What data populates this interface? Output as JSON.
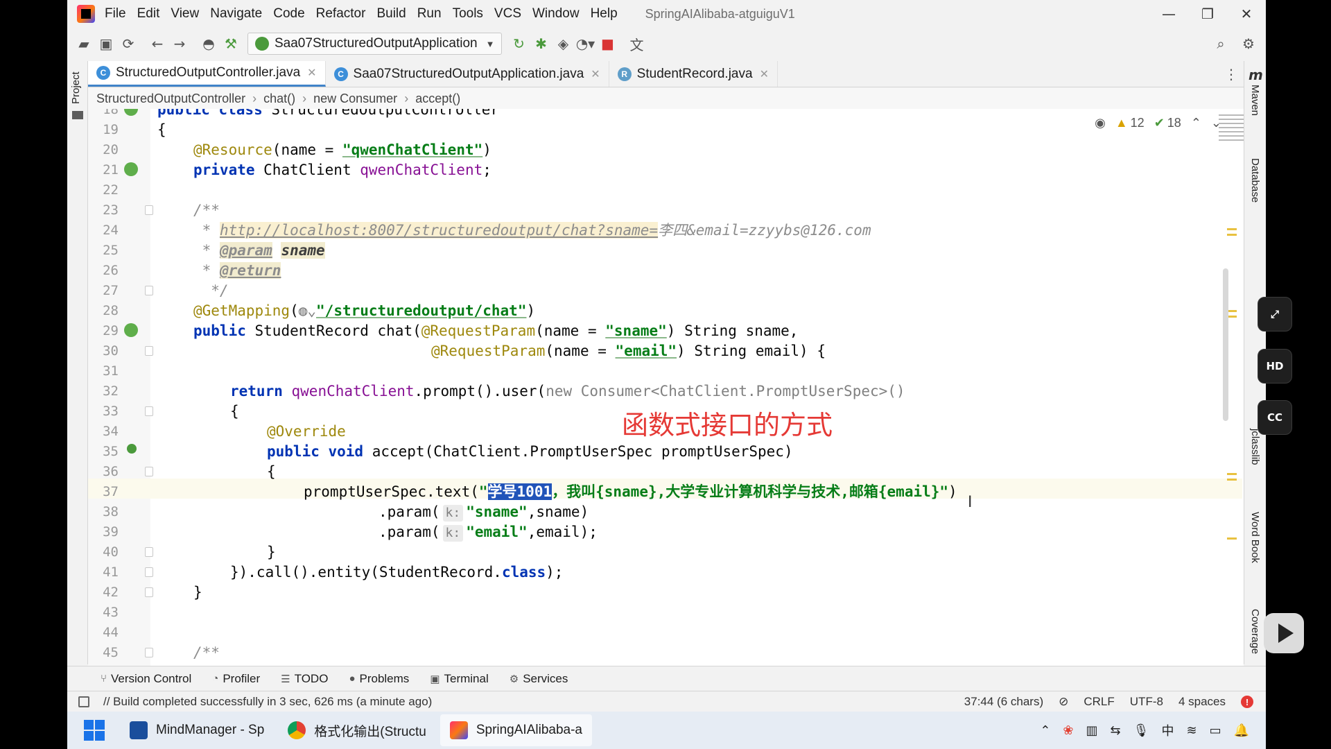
{
  "window": {
    "menu": [
      "File",
      "Edit",
      "View",
      "Navigate",
      "Code",
      "Refactor",
      "Build",
      "Run",
      "Tools",
      "VCS",
      "Window",
      "Help"
    ],
    "project_title": "SpringAIAlibaba-atguiguV1",
    "minimize": "—",
    "maximize": "❐",
    "close": "✕"
  },
  "toolbar": {
    "run_config": "Saa07StructuredOutputApplication",
    "icons": [
      "open-icon",
      "save-icon",
      "sync-icon",
      "back-icon",
      "forward-icon",
      "user-icon",
      "build-hammer-icon",
      "rerun-icon",
      "debug-icon",
      "coverage-icon",
      "profile-icon",
      "stop-icon",
      "translate-icon",
      "search-icon",
      "settings-icon"
    ]
  },
  "left_strip": {
    "project_label": "Project"
  },
  "right_strip": {
    "maven": "Maven",
    "database": "Database",
    "jclasslib": "jclasslib",
    "word_book": "Word Book",
    "coverage": "Coverage"
  },
  "tabs": [
    {
      "label": "StructuredOutputController.java",
      "icon": "C",
      "active": true
    },
    {
      "label": "Saa07StructuredOutputApplication.java",
      "icon": "C",
      "active": false
    },
    {
      "label": "StudentRecord.java",
      "icon": "R",
      "active": false
    }
  ],
  "breadcrumb": [
    "StructuredOutputController",
    "chat()",
    "new Consumer",
    "accept()"
  ],
  "inspections": {
    "warnings": "12",
    "weak_warnings": "18"
  },
  "editor": {
    "cursor_line": "37",
    "annotation_note": "函数式接口的方式",
    "lines": [
      {
        "n": "18",
        "text": "public class StructuredOutputController"
      },
      {
        "n": "19",
        "text": "{"
      },
      {
        "n": "20",
        "text": "@Resource(name = \"qwenChatClient\")"
      },
      {
        "n": "21",
        "text": "private ChatClient qwenChatClient;"
      },
      {
        "n": "22",
        "text": ""
      },
      {
        "n": "23",
        "text": "/**"
      },
      {
        "n": "24",
        "text": "http://localhost:8007/structuredoutput/chat?sname=李四&email=zzyybs@126.com"
      },
      {
        "n": "25",
        "text": "@param sname"
      },
      {
        "n": "26",
        "text": "@return"
      },
      {
        "n": "27",
        "text": "*/"
      },
      {
        "n": "28",
        "text": "@GetMapping(\"/structuredoutput/chat\")"
      },
      {
        "n": "29",
        "text": "public StudentRecord chat(@RequestParam(name = \"sname\") String sname,"
      },
      {
        "n": "30",
        "text": "@RequestParam(name = \"email\") String email) {"
      },
      {
        "n": "31",
        "text": ""
      },
      {
        "n": "32",
        "text": "return qwenChatClient.prompt().user(new Consumer<ChatClient.PromptUserSpec>()"
      },
      {
        "n": "33",
        "text": "{"
      },
      {
        "n": "34",
        "text": "@Override"
      },
      {
        "n": "35",
        "text": "public void accept(ChatClient.PromptUserSpec promptUserSpec)"
      },
      {
        "n": "36",
        "text": "{"
      },
      {
        "n": "37",
        "text": "promptUserSpec.text(\"学号1001，我叫{sname},大学专业计算机科学与技术,邮箱{email}\")"
      },
      {
        "n": "38",
        "text": ".param( k: \"sname\",sname)"
      },
      {
        "n": "39",
        "text": ".param( k: \"email\",email);"
      },
      {
        "n": "40",
        "text": "}"
      },
      {
        "n": "41",
        "text": "}).call().entity(StudentRecord.class);"
      },
      {
        "n": "42",
        "text": "}"
      },
      {
        "n": "43",
        "text": ""
      },
      {
        "n": "44",
        "text": ""
      },
      {
        "n": "45",
        "text": "/**"
      }
    ],
    "selection": "学号1001"
  },
  "toolwindows": [
    {
      "label": "Version Control",
      "icon": "branch-icon"
    },
    {
      "label": "Profiler",
      "icon": "profiler-icon"
    },
    {
      "label": "TODO",
      "icon": "todo-icon"
    },
    {
      "label": "Problems",
      "icon": "problems-icon"
    },
    {
      "label": "Terminal",
      "icon": "terminal-icon"
    },
    {
      "label": "Services",
      "icon": "services-icon"
    }
  ],
  "status": {
    "message": "// Build completed successfully in 3 sec, 626 ms (a minute ago)",
    "position": "37:44 (6 chars)",
    "line_sep": "CRLF",
    "encoding": "UTF-8",
    "indent": "4 spaces"
  },
  "taskbar": {
    "apps": [
      {
        "label": "MindManager - Sp",
        "color": "#1a4e9c"
      },
      {
        "label": "格式化输出(Structu",
        "color": "#e34133"
      },
      {
        "label": "SpringAIAlibaba-a",
        "color": "#000000"
      }
    ],
    "ime": "中"
  },
  "overlay": {
    "hd": "HD",
    "cc": "CC"
  }
}
